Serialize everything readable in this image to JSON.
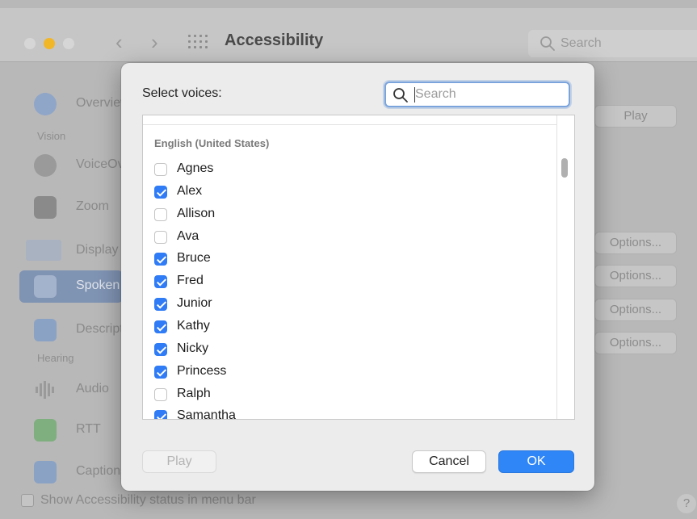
{
  "window": {
    "title": "Accessibility",
    "search_placeholder": "Search",
    "back_arrow": "‹",
    "forward_arrow": "›"
  },
  "sidebar": {
    "sections": [
      {
        "label": "Vision"
      },
      {
        "label": "Hearing"
      }
    ],
    "items": [
      {
        "label": "Overview",
        "icon": "accessibility-icon"
      },
      {
        "label": "VoiceOver",
        "icon": "voiceover-icon"
      },
      {
        "label": "Zoom",
        "icon": "zoom-icon"
      },
      {
        "label": "Display",
        "icon": "display-icon"
      },
      {
        "label": "Spoken Content",
        "icon": "spoken-content-icon",
        "selected": true
      },
      {
        "label": "Descriptions",
        "icon": "descriptions-icon"
      },
      {
        "label": "Audio",
        "icon": "audio-icon"
      },
      {
        "label": "RTT",
        "icon": "rtt-icon"
      },
      {
        "label": "Captions",
        "icon": "captions-icon"
      }
    ]
  },
  "right_panel": {
    "play_label": "Play",
    "options_labels": [
      "Options...",
      "Options...",
      "Options...",
      "Options..."
    ]
  },
  "status_bar": {
    "label": "Show Accessibility status in menu bar",
    "help": "?"
  },
  "dialog": {
    "title": "Select voices:",
    "search_placeholder": "Search",
    "group_header": "English (United States)",
    "voices": [
      {
        "name": "Agnes",
        "checked": false
      },
      {
        "name": "Alex",
        "checked": true
      },
      {
        "name": "Allison",
        "checked": false
      },
      {
        "name": "Ava",
        "checked": false
      },
      {
        "name": "Bruce",
        "checked": true
      },
      {
        "name": "Fred",
        "checked": true
      },
      {
        "name": "Junior",
        "checked": true
      },
      {
        "name": "Kathy",
        "checked": true
      },
      {
        "name": "Nicky",
        "checked": true
      },
      {
        "name": "Princess",
        "checked": true
      },
      {
        "name": "Ralph",
        "checked": false
      },
      {
        "name": "Samantha",
        "checked": true
      }
    ],
    "play_label": "Play",
    "cancel_label": "Cancel",
    "ok_label": "OK"
  },
  "colors": {
    "accent": "#2f86f6",
    "checkbox_on": "#2f7cf6",
    "sidebar_selected": "#7f93b3"
  }
}
